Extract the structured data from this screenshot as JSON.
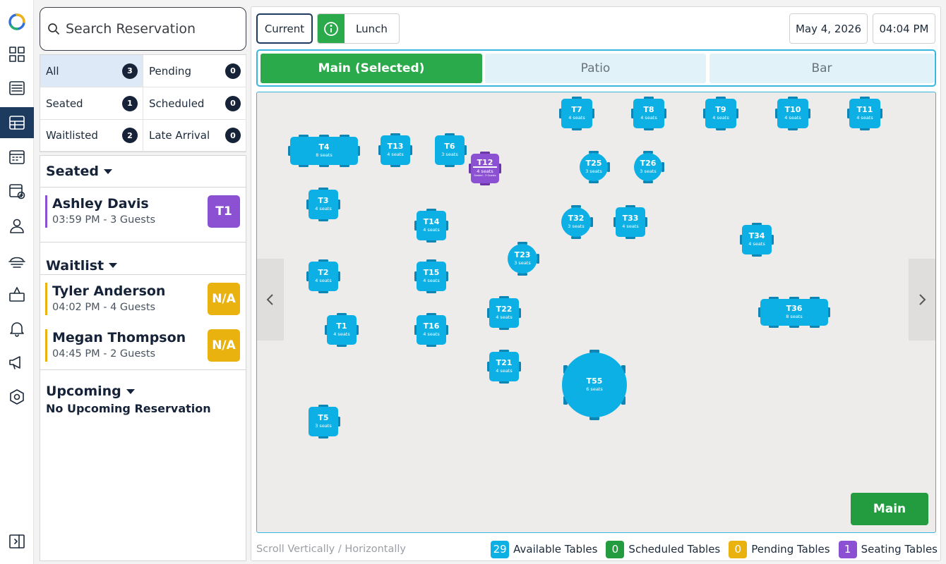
{
  "search": {
    "placeholder": "Search Reservation"
  },
  "filters": [
    {
      "label": "All",
      "count": "3"
    },
    {
      "label": "Pending",
      "count": "0"
    },
    {
      "label": "Seated",
      "count": "1"
    },
    {
      "label": "Scheduled",
      "count": "0"
    },
    {
      "label": "Waitlisted",
      "count": "2"
    },
    {
      "label": "Late Arrival",
      "count": "0"
    }
  ],
  "sections": {
    "seated": {
      "title": "Seated",
      "items": [
        {
          "name": "Ashley Davis",
          "time": "03:59 PM - 3 Guests",
          "tag": "T1"
        }
      ]
    },
    "waitlist": {
      "title": "Waitlist",
      "items": [
        {
          "name": "Tyler Anderson",
          "time": "04:02 PM - 4 Guests",
          "tag": "N/A"
        },
        {
          "name": "Megan Thompson",
          "time": "04:45 PM - 2 Guests",
          "tag": "N/A"
        }
      ]
    },
    "upcoming": {
      "title": "Upcoming",
      "empty": "No Upcoming Reservation"
    }
  },
  "header": {
    "current": "Current",
    "meal": "Lunch",
    "date": "May 4, 2026",
    "time": "04:04 PM"
  },
  "areas": [
    "Main (Selected)",
    "Patio",
    "Bar"
  ],
  "floor_button": "Main",
  "tables": [
    {
      "id": "T7",
      "seats": "4 seats"
    },
    {
      "id": "T8",
      "seats": "4 seats"
    },
    {
      "id": "T9",
      "seats": "4 seats"
    },
    {
      "id": "T10",
      "seats": "4 seats"
    },
    {
      "id": "T11",
      "seats": "4 seats"
    },
    {
      "id": "T4",
      "seats": "8 seats"
    },
    {
      "id": "T13",
      "seats": "4 seats"
    },
    {
      "id": "T6",
      "seats": "3 seats"
    },
    {
      "id": "T12",
      "seats": "4 seats",
      "note": "Seated - 3 Guests"
    },
    {
      "id": "T25",
      "seats": "3 seats"
    },
    {
      "id": "T26",
      "seats": "3 seats"
    },
    {
      "id": "T3",
      "seats": "4 seats"
    },
    {
      "id": "T14",
      "seats": "4 seats"
    },
    {
      "id": "T32",
      "seats": "3 seats"
    },
    {
      "id": "T33",
      "seats": "4 seats"
    },
    {
      "id": "T34",
      "seats": "4 seats"
    },
    {
      "id": "T23",
      "seats": "3 seats"
    },
    {
      "id": "T2",
      "seats": "4 seats"
    },
    {
      "id": "T15",
      "seats": "4 seats"
    },
    {
      "id": "T22",
      "seats": "4 seats"
    },
    {
      "id": "T36",
      "seats": "8 seats"
    },
    {
      "id": "T1",
      "seats": "4 seats"
    },
    {
      "id": "T16",
      "seats": "4 seats"
    },
    {
      "id": "T21",
      "seats": "4 seats"
    },
    {
      "id": "T55",
      "seats": "6 seats"
    },
    {
      "id": "T5",
      "seats": "3 seats"
    }
  ],
  "footer": {
    "hint": "Scroll Vertically / Horizontally",
    "legend": [
      {
        "count": "29",
        "label": "Available Tables",
        "color": "#0cb0e4"
      },
      {
        "count": "0",
        "label": "Scheduled Tables",
        "color": "#239c40"
      },
      {
        "count": "0",
        "label": "Pending Tables",
        "color": "#e9b20e"
      },
      {
        "count": "1",
        "label": "Seating Tables",
        "color": "#8c50d2"
      }
    ]
  },
  "colors": {
    "accent": "#1d3a5f",
    "available": "#0cb0e4",
    "selected_tab": "#2aaa4a",
    "seated": "#8c50d2",
    "waitlist": "#e9b20e"
  }
}
